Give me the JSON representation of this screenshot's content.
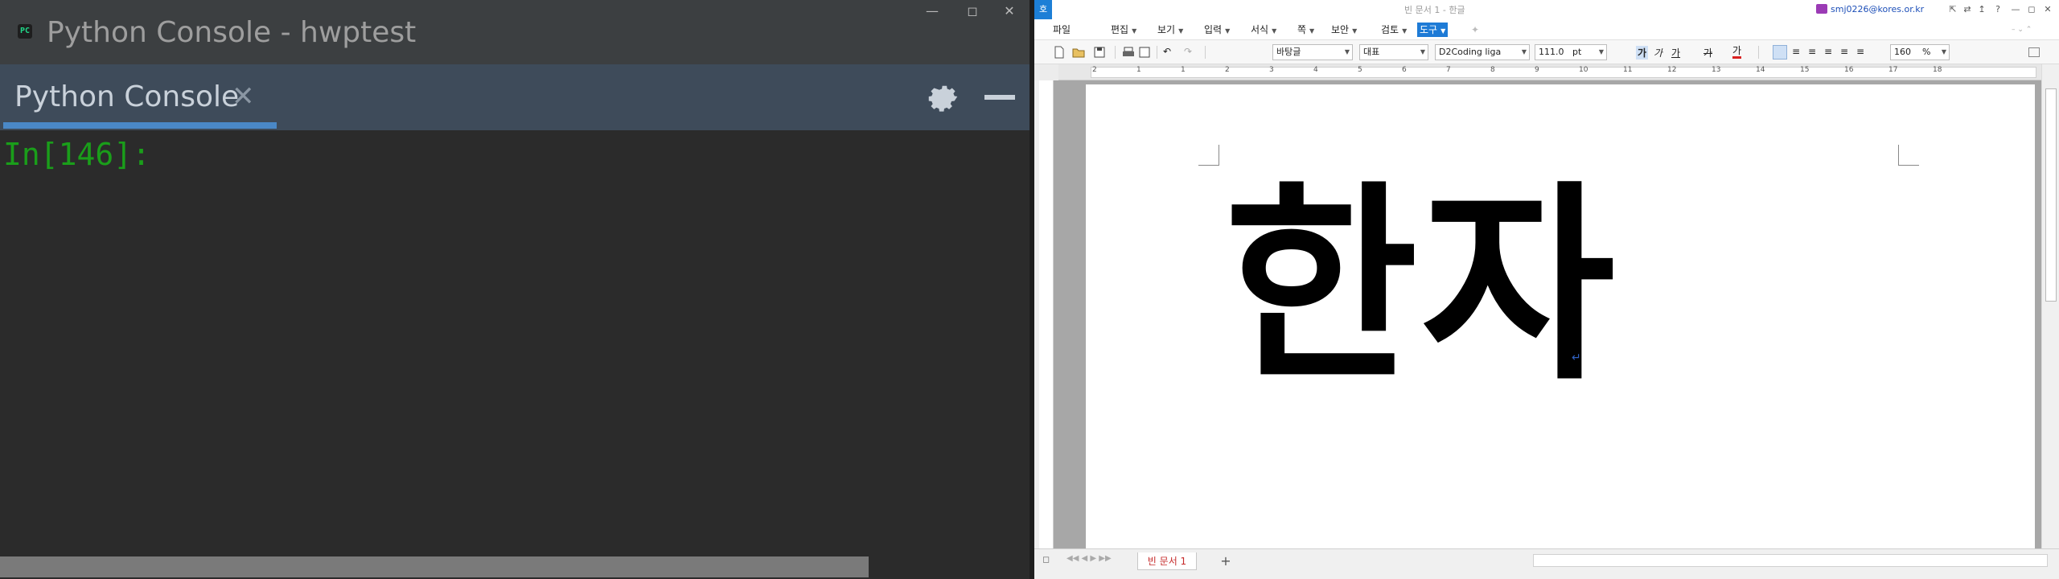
{
  "python_console": {
    "app_icon": "PC",
    "window_title": "Python Console - hwptest",
    "tab_label": "Python Console",
    "tab_close_icon": "close-icon",
    "settings_icon": "gear-icon",
    "minimize_icon": "minus-icon",
    "prompt": "In[146]:",
    "prompt_color": "#1a9e1a",
    "accent_color": "#4a88c7"
  },
  "hwp": {
    "logo": "호",
    "document_title": "빈 문서 1 - 한글",
    "user_email": "smj0226@kores.or.kr",
    "menu": [
      {
        "label": "파일",
        "dropdown": false,
        "active": false
      },
      {
        "label": "편집",
        "dropdown": true,
        "active": false
      },
      {
        "label": "보기",
        "dropdown": true,
        "active": false
      },
      {
        "label": "입력",
        "dropdown": true,
        "active": false
      },
      {
        "label": "서식",
        "dropdown": true,
        "active": false
      },
      {
        "label": "쪽",
        "dropdown": true,
        "active": false
      },
      {
        "label": "보안",
        "dropdown": true,
        "active": false
      },
      {
        "label": "검토",
        "dropdown": true,
        "active": false
      },
      {
        "label": "도구",
        "dropdown": true,
        "active": true
      }
    ],
    "toolbar": {
      "style_combo": "바탕글",
      "lang_combo": "대표",
      "font_combo": "D2Coding liga",
      "size_value": "111.0",
      "size_unit": "pt",
      "bold_label": "가",
      "italic_label": "가",
      "underline_label": "가",
      "strike_label": "가",
      "color_label": "가",
      "zoom_value": "160",
      "zoom_unit": "%"
    },
    "document_text": "한자",
    "page_tab": "빈 문서 1",
    "add_tab": "+",
    "ruler_numbers": [
      "2",
      "1",
      "1",
      "2",
      "3",
      "4",
      "5",
      "6",
      "7",
      "8",
      "9",
      "10",
      "11",
      "12",
      "13",
      "14",
      "15",
      "16",
      "17",
      "18"
    ]
  }
}
